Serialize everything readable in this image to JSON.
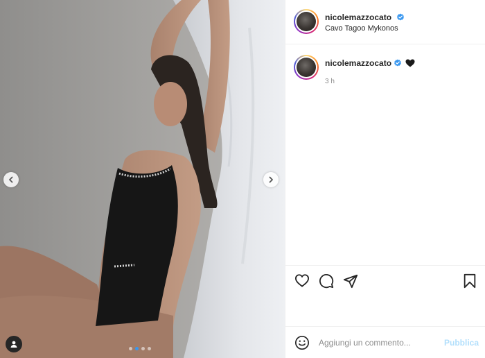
{
  "post": {
    "username": "nicolemazzocato",
    "verified": true,
    "location": "Cavo Tagoo Mykonos",
    "caption_emoji": "🖤",
    "timestamp": "3 h"
  },
  "carousel": {
    "current_index": 2,
    "total": 4
  },
  "icons": {
    "verified": "verified-badge-icon",
    "like": "heart-outline-icon",
    "comment": "speech-bubble-icon",
    "share": "paper-plane-icon",
    "save": "bookmark-icon",
    "emoji": "smiley-icon",
    "prev": "chevron-left-icon",
    "next": "chevron-right-icon",
    "tags": "user-tag-icon"
  },
  "comment_box": {
    "placeholder": "Aggiungi un commento...",
    "submit_label": "Pubblica"
  },
  "colors": {
    "verified_blue": "#3897f0",
    "publish_disabled": "#b2dffc",
    "text_primary": "#262626",
    "text_secondary": "#8e8e8e"
  }
}
